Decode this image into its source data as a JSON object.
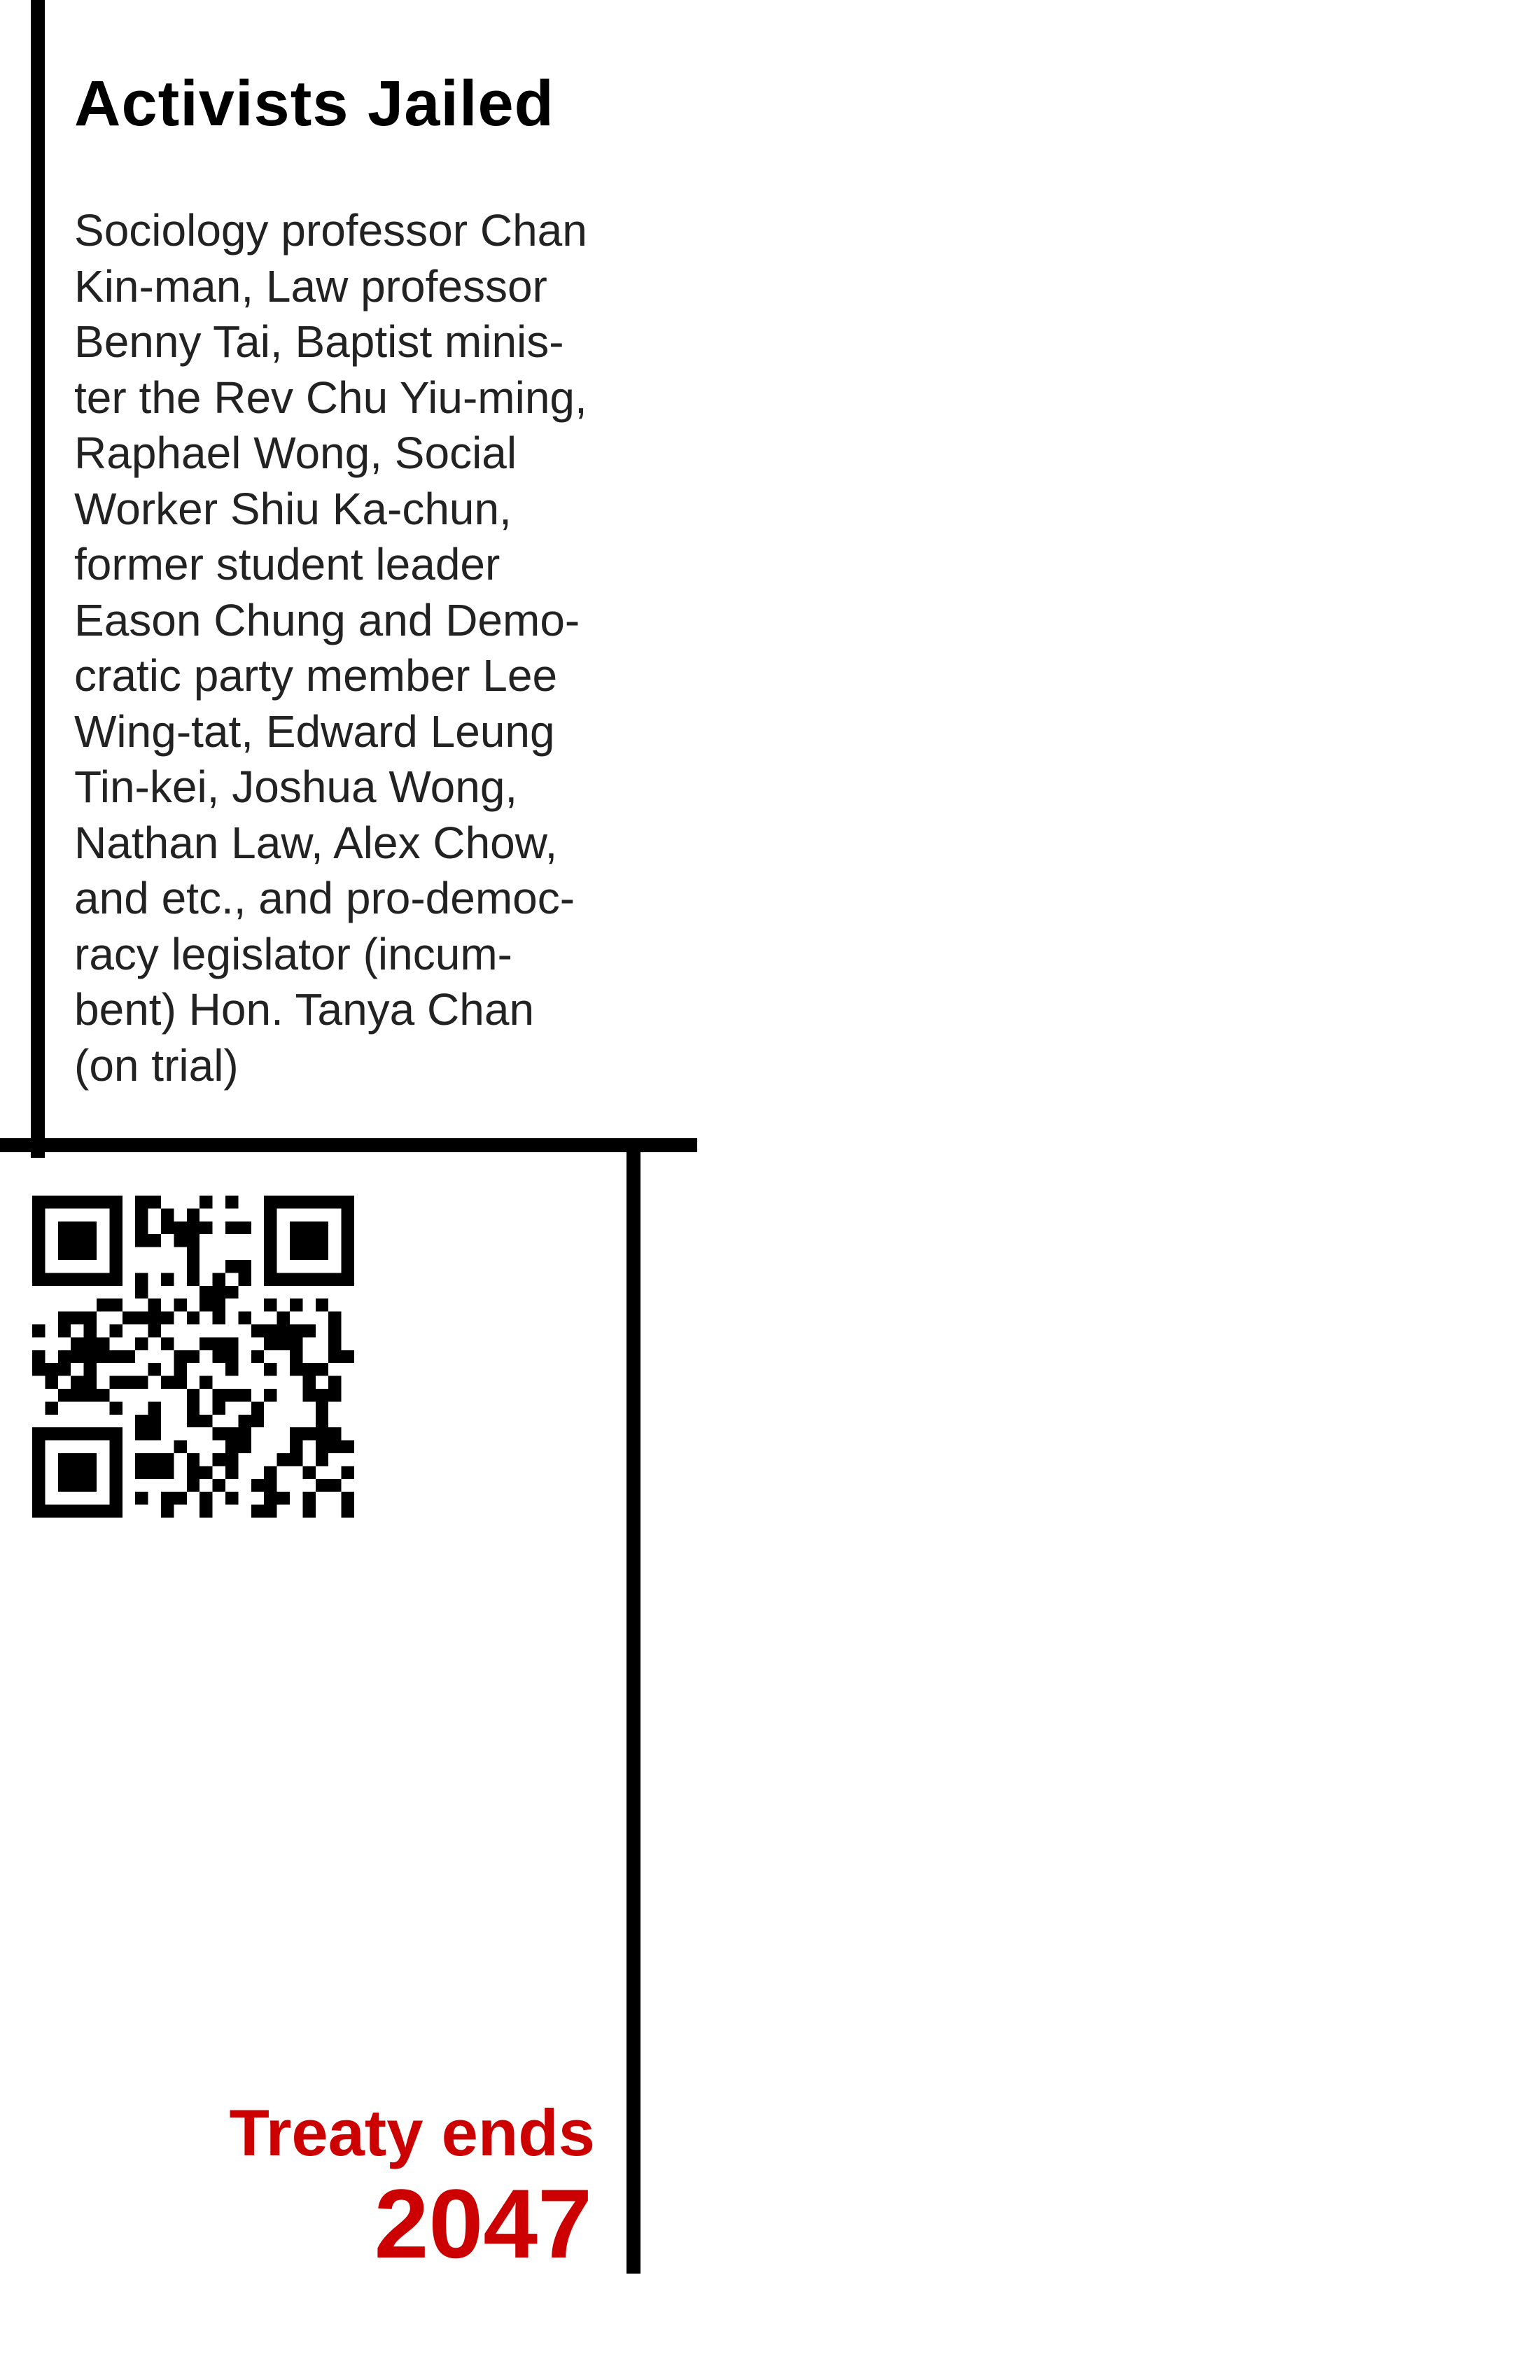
{
  "article": {
    "title": "Activists Jailed",
    "body_lines": [
      "Sociology professor Chan",
      "Kin-man, Law professor",
      "Benny Tai, Baptist minis-",
      "ter the Rev Chu Yiu-ming,",
      "Raphael Wong, Social",
      "Worker Shiu Ka-chun,",
      "former student leader",
      "Eason Chung and Demo-",
      "cratic party member Lee",
      "Wing-tat, Edward Leung",
      "Tin-kei, Joshua Wong,",
      "Nathan Law, Alex Chow,",
      "and etc., and pro-democ-",
      "racy legislator (incum-",
      "bent) Hon. Tanya Chan",
      "(on trial)"
    ]
  },
  "qr": {
    "icon": "qr-code-icon"
  },
  "footer": {
    "treaty_label": "Treaty ends",
    "treaty_year": "2047"
  },
  "colors": {
    "accent": "#cc0000",
    "rule": "#000000",
    "background": "#ffffff"
  }
}
